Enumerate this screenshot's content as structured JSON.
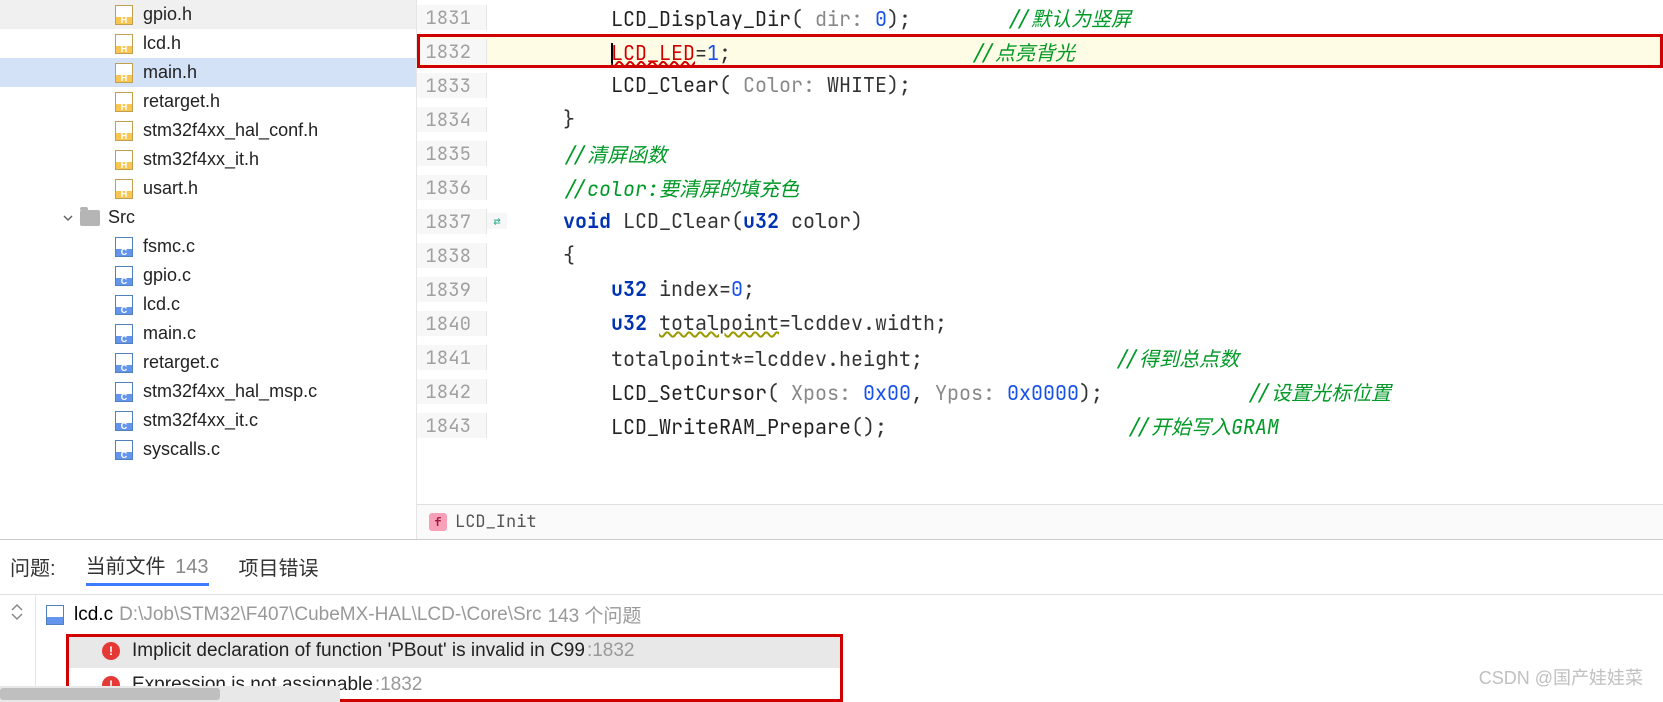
{
  "sidebar": {
    "header_files": [
      {
        "name": "gpio.h",
        "type": "h"
      },
      {
        "name": "lcd.h",
        "type": "h"
      },
      {
        "name": "main.h",
        "type": "h",
        "selected": true
      },
      {
        "name": "retarget.h",
        "type": "h"
      },
      {
        "name": "stm32f4xx_hal_conf.h",
        "type": "h"
      },
      {
        "name": "stm32f4xx_it.h",
        "type": "h"
      },
      {
        "name": "usart.h",
        "type": "h"
      }
    ],
    "folder": "Src",
    "src_files": [
      {
        "name": "fsmc.c",
        "type": "c"
      },
      {
        "name": "gpio.c",
        "type": "c"
      },
      {
        "name": "lcd.c",
        "type": "c"
      },
      {
        "name": "main.c",
        "type": "c"
      },
      {
        "name": "retarget.c",
        "type": "c"
      },
      {
        "name": "stm32f4xx_hal_msp.c",
        "type": "c"
      },
      {
        "name": "stm32f4xx_it.c",
        "type": "c"
      },
      {
        "name": "syscalls.c",
        "type": "c"
      }
    ]
  },
  "editor": {
    "lines": [
      {
        "n": 1831,
        "indent": "        ",
        "tokens": [
          {
            "t": "fn",
            "v": "LCD_Display_Dir"
          },
          {
            "t": "",
            "v": "( "
          },
          {
            "t": "param",
            "v": "dir: "
          },
          {
            "t": "num",
            "v": "0"
          },
          {
            "t": "",
            "v": ");"
          },
          {
            "t": "sp",
            "v": "        "
          },
          {
            "t": "comment",
            "v": "//默认为竖屏"
          }
        ]
      },
      {
        "n": 1832,
        "hl": true,
        "indent": "        ",
        "tokens": [
          {
            "t": "caret",
            "v": ""
          },
          {
            "t": "err",
            "v": "LCD_LED"
          },
          {
            "t": "",
            "v": "="
          },
          {
            "t": "num",
            "v": "1"
          },
          {
            "t": "",
            "v": ";"
          },
          {
            "t": "sp",
            "v": "                    "
          },
          {
            "t": "comment",
            "v": "//点亮背光"
          }
        ]
      },
      {
        "n": 1833,
        "indent": "        ",
        "tokens": [
          {
            "t": "fn",
            "v": "LCD_Clear"
          },
          {
            "t": "",
            "v": "( "
          },
          {
            "t": "param",
            "v": "Color: "
          },
          {
            "t": "",
            "v": "WHITE);"
          }
        ]
      },
      {
        "n": 1834,
        "indent": "    ",
        "fold": "}",
        "tokens": [
          {
            "t": "",
            "v": "}"
          }
        ]
      },
      {
        "n": 1835,
        "indent": "    ",
        "tokens": [
          {
            "t": "comment",
            "v": "//清屏函数"
          }
        ]
      },
      {
        "n": 1836,
        "indent": "    ",
        "tokens": [
          {
            "t": "comment",
            "v": "//color:要清屏的填充色"
          }
        ]
      },
      {
        "n": 1837,
        "indent": "    ",
        "fold": "-",
        "change": true,
        "tokens": [
          {
            "t": "kw",
            "v": "void"
          },
          {
            "t": "",
            "v": " LCD_Clear("
          },
          {
            "t": "kw",
            "v": "u32"
          },
          {
            "t": "",
            "v": " color)"
          }
        ]
      },
      {
        "n": 1838,
        "indent": "    ",
        "tokens": [
          {
            "t": "",
            "v": "{"
          }
        ]
      },
      {
        "n": 1839,
        "indent": "        ",
        "tokens": [
          {
            "t": "kw",
            "v": "u32"
          },
          {
            "t": "",
            "v": " index="
          },
          {
            "t": "num",
            "v": "0"
          },
          {
            "t": "",
            "v": ";"
          }
        ]
      },
      {
        "n": 1840,
        "indent": "        ",
        "tokens": [
          {
            "t": "kw",
            "v": "u32"
          },
          {
            "t": "",
            "v": " "
          },
          {
            "t": "warn",
            "v": "totalpoint"
          },
          {
            "t": "",
            "v": "=lcddev.width;"
          }
        ]
      },
      {
        "n": 1841,
        "indent": "        ",
        "tokens": [
          {
            "t": "",
            "v": "totalpoint*=lcddev.height;"
          },
          {
            "t": "sp",
            "v": "                "
          },
          {
            "t": "comment",
            "v": "//得到总点数"
          }
        ]
      },
      {
        "n": 1842,
        "indent": "        ",
        "tokens": [
          {
            "t": "fn",
            "v": "LCD_SetCursor"
          },
          {
            "t": "",
            "v": "( "
          },
          {
            "t": "param",
            "v": "Xpos: "
          },
          {
            "t": "num",
            "v": "0x00"
          },
          {
            "t": "",
            "v": ", "
          },
          {
            "t": "param",
            "v": "Ypos: "
          },
          {
            "t": "num",
            "v": "0x0000"
          },
          {
            "t": "",
            "v": ");"
          },
          {
            "t": "sp",
            "v": "            "
          },
          {
            "t": "comment",
            "v": "//设置光标位置"
          }
        ]
      },
      {
        "n": 1843,
        "indent": "        ",
        "tokens": [
          {
            "t": "fn",
            "v": "LCD_WriteRAM_Prepare"
          },
          {
            "t": "",
            "v": "();"
          },
          {
            "t": "sp",
            "v": "                    "
          },
          {
            "t": "comment",
            "v": "//开始写入GRAM"
          }
        ]
      }
    ],
    "breadcrumb_fn": "LCD_Init"
  },
  "problems": {
    "title": "问题:",
    "tab_current": "当前文件",
    "current_count": "143",
    "tab_project": "项目错误",
    "file_name": "lcd.c",
    "file_path": "D:\\Job\\STM32\\F407\\CubeMX-HAL\\LCD-\\Core\\Src",
    "file_count_label": "143 个问题",
    "items": [
      {
        "msg": "Implicit declaration of function 'PBout' is invalid in C99",
        "line": ":1832",
        "sel": true
      },
      {
        "msg": "Expression is not assignable",
        "line": ":1832",
        "sel": false
      }
    ]
  },
  "watermark": "CSDN @国产娃娃菜"
}
